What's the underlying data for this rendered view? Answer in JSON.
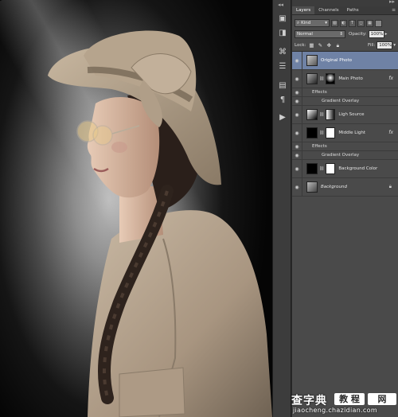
{
  "panel": {
    "tabs": [
      "Layers",
      "Channels",
      "Paths"
    ],
    "filter_kind": "Kind",
    "blend_mode": "Normal",
    "opacity_label": "Opacity:",
    "opacity_value": "100%",
    "lock_label": "Lock:",
    "fill_label": "Fill:",
    "fill_value": "100%"
  },
  "layers": {
    "original": {
      "name": "Original Photo"
    },
    "main": {
      "name": "Main Photo",
      "fx": "fx",
      "effects": "Effects",
      "effect_item": "Gradient Overlay"
    },
    "light_source": {
      "name": "Ligh Source"
    },
    "middle_light": {
      "name": "Middle Light",
      "fx": "fx",
      "effects": "Effects",
      "effect_item": "Gradient Overlay"
    },
    "bg_color": {
      "name": "Background Color"
    },
    "background": {
      "name": "Background"
    }
  },
  "watermark": {
    "site_name": "查字典",
    "badge1": "教 程",
    "badge2": "网",
    "url": "jiaocheng.chazidian.com"
  },
  "colors": {
    "panel_bg": "#4a4a4a",
    "selected_layer": "#6f82a5",
    "toolstrip": "#3c3c3c"
  }
}
